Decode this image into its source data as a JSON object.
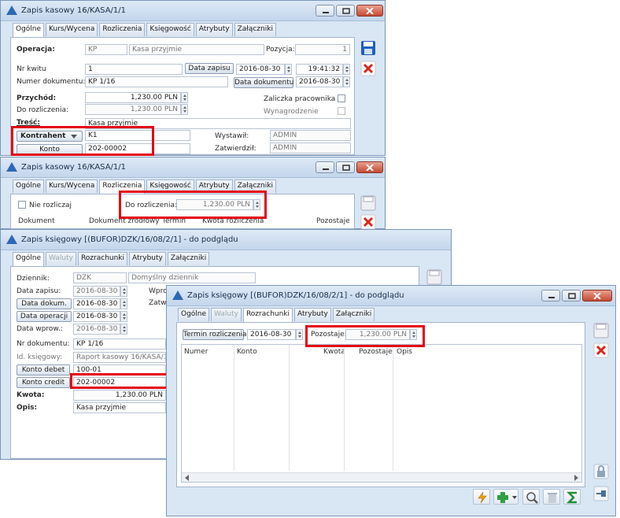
{
  "w1": {
    "title": "Zapis kasowy 16/KASA/1/1",
    "tabs": [
      "Ogólne",
      "Kurs/Wycena",
      "Rozliczenia",
      "Księgowość",
      "Atrybuty",
      "Załączniki"
    ],
    "operacja_label": "Operacja:",
    "operacja_code": "KP",
    "operacja_name": "Kasa przyjmie",
    "pozycja_label": "Pozycja:",
    "pozycja_value": "1",
    "nr_kwitu_label": "Nr kwitu",
    "nr_kwitu_value": "1",
    "data_zapisu_btn": "Data zapisu",
    "data_zapisu": "2016-08-30",
    "czas": "19:41:32",
    "numer_dok_label": "Numer dokumentu:",
    "numer_dok_value": "KP 1/16",
    "data_dokumentu_btn": "Data dokumentu",
    "data_dokumentu": "2016-08-30",
    "przychod_label": "Przychód:",
    "przychod_value": "1,230.00 PLN",
    "do_rozliczenia_label": "Do rozliczenia:",
    "do_rozliczenia_value": "1,230.00 PLN",
    "zaliczka_label": "Zaliczka pracownika",
    "wynagrodzenie_label": "Wynagrodzenie",
    "tresc_label": "Treść:",
    "tresc_value": "Kasa przyjmie",
    "kontrahent_btn": "Kontrahent",
    "kontrahent_value": "K1",
    "konto_btn": "Konto",
    "konto_value": "202-00002",
    "wystawil_label": "Wystawił:",
    "wystawil_value": "ADMIN",
    "zatwierdzil_label": "Zatwierdził:",
    "zatwierdzil_value": "ADMIN"
  },
  "w2": {
    "title": "Zapis kasowy 16/KASA/1/1",
    "tabs": [
      "Ogólne",
      "Kurs/Wycena",
      "Rozliczenia",
      "Księgowość",
      "Atrybuty",
      "Załączniki"
    ],
    "nie_rozliczaj_label": "Nie rozliczaj",
    "do_rozliczenia_label": "Do rozliczenia:",
    "do_rozliczenia_value": "1,230.00 PLN",
    "columns": [
      "Dokument",
      "Dokument źródłowy",
      "Termin",
      "Kwota rozliczenia",
      "Pozostaje"
    ]
  },
  "w3": {
    "title": "Zapis księgowy [(BUFOR)DZK/16/08/2/1] - do podglądu",
    "tabs": [
      "Ogólne",
      "Waluty",
      "Rozrachunki",
      "Atrybuty",
      "Załączniki"
    ],
    "dziennik_label": "Dziennik:",
    "dziennik_code": "DZK",
    "dziennik_name": "Domyślny dziennik",
    "data_zapisu_label": "Data zapisu:",
    "data_zapisu_value": "2016-08-30",
    "wprow_label": "Wprow",
    "zatw_label": "Zatwi",
    "data_dok_btn": "Data dokum.",
    "data_dok_value": "2016-08-30",
    "data_oper_btn": "Data operacji",
    "data_oper_value": "2016-08-30",
    "data_wprow_label": "Data wprow.:",
    "data_wprow_value": "2016-08-30",
    "nr_dok_label": "Nr dokumentu:",
    "nr_dok_value": "KP 1/16",
    "id_ksieg_label": "Id. księgowy:",
    "id_ksieg_value": "Raport kasowy 16/KASA/1",
    "konto_debet_btn": "Konto debet",
    "konto_debet_value": "100-01",
    "konto_credit_btn": "Konto credit",
    "konto_credit_value": "202-00002",
    "kwota_label": "Kwota:",
    "kwota_value": "1,230.00 PLN",
    "opis_label": "Opis:",
    "opis_value": "Kasa przyjmie"
  },
  "w4": {
    "title": "Zapis księgowy [(BUFOR)DZK/16/08/2/1] - do podglądu",
    "tabs": [
      "Ogólne",
      "Waluty",
      "Rozrachunki",
      "Atrybuty",
      "Załączniki"
    ],
    "termin_btn": "Termin rozliczenia",
    "termin_value": "2016-08-30",
    "pozostaje_label": "Pozostaje:",
    "pozostaje_value": "1,230.00 PLN",
    "columns": [
      "Numer",
      "Konto",
      "Kwota",
      "Pozostaje",
      "Opis"
    ]
  },
  "colors": {
    "highlight": "#e30613",
    "title_icon": "#2d69b4",
    "save_icon": "#1f5fbf",
    "delete_icon": "#d9261c"
  },
  "icons": [
    "app-triangle-icon",
    "minimize-icon",
    "maximize-icon",
    "close-icon",
    "save-icon",
    "delete-icon",
    "flash-icon",
    "add-icon",
    "zoom-icon",
    "trash-icon",
    "sum-icon",
    "lock-icon",
    "pin-icon"
  ]
}
